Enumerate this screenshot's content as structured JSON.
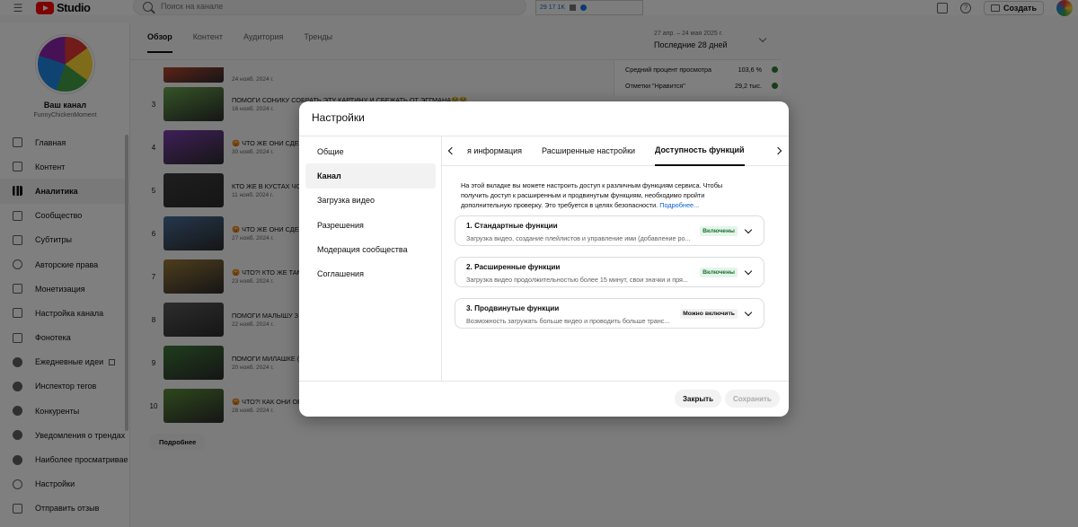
{
  "topbar": {
    "studio_label": "Studio",
    "search_placeholder": "Поиск на канале",
    "extension_text": "29 17 1K",
    "create_label": "Создать"
  },
  "sidebar": {
    "channel_name": "Ваш канал",
    "channel_handle": "FunnyChickenMoment",
    "items": [
      {
        "label": "Главная",
        "active": false
      },
      {
        "label": "Контент",
        "active": false
      },
      {
        "label": "Аналитика",
        "active": true
      },
      {
        "label": "Сообщество",
        "active": false
      },
      {
        "label": "Субтитры",
        "active": false
      },
      {
        "label": "Авторские права",
        "active": false
      },
      {
        "label": "Монетизация",
        "active": false
      },
      {
        "label": "Настройка канала",
        "active": false
      },
      {
        "label": "Фонотека",
        "active": false
      },
      {
        "label": "Ежедневные идеи",
        "active": false
      },
      {
        "label": "Инспектор тегов",
        "active": false
      },
      {
        "label": "Конкуренты",
        "active": false
      },
      {
        "label": "Уведомления о трендах",
        "active": false
      },
      {
        "label": "Наиболее просматривае",
        "active": false
      },
      {
        "label": "Настройки",
        "active": false
      },
      {
        "label": "Отправить отзыв",
        "active": false
      }
    ]
  },
  "main": {
    "tabs": [
      "Обзор",
      "Контент",
      "Аудитория",
      "Тренды"
    ],
    "date_range": "27 апр. – 24 мая 2025 г.",
    "date_label": "Последние 28 дней",
    "more_button": "Подробнее",
    "stats": [
      {
        "label": "Средний процент просмотра",
        "value": "103,6 %"
      },
      {
        "label": "Отметки \"Нравится\"",
        "value": "29,2 тыс."
      }
    ],
    "videos": [
      {
        "rank": "",
        "title": "",
        "date": "24 нояб. 2024 г.",
        "color": "#b8462e"
      },
      {
        "rank": "3",
        "title": "ПОМОГИ СОНИКУ СОБРАТЬ ЭТУ КАРТИНУ И СБЕЖАТЬ ОТ ЭГГМАНА😭😭",
        "date": "16 нояб. 2024 г.",
        "color": "#6aa84f"
      },
      {
        "rank": "4",
        "title": "😡 ЧТО ЖЕ ОНИ СДЕЛ",
        "date": "30 нояб. 2024 г.",
        "color": "#7d3fb0"
      },
      {
        "rank": "5",
        "title": "КТО ЖЕ В КУСТАХ ЧО",
        "date": "11 нояб. 2024 г.",
        "color": "#3d3d3d"
      },
      {
        "rank": "6",
        "title": "😡 ЧТО ЖЕ ОНИ СДЕЛА",
        "date": "27 нояб. 2024 г.",
        "color": "#4a6f9a"
      },
      {
        "rank": "7",
        "title": "😡 ЧТО?! КТО ЖЕ ТАМ",
        "date": "23 нояб. 2024 г.",
        "color": "#9c7b3a"
      },
      {
        "rank": "8",
        "title": "ПОМОГИ МАЛЫШУ З",
        "date": "22 нояб. 2024 г.",
        "color": "#5a5a5a"
      },
      {
        "rank": "9",
        "title": "ПОМОГИ МИЛАШКЕ (",
        "date": "20 нояб. 2024 г.",
        "color": "#3f7a3a"
      },
      {
        "rank": "10",
        "title": "😡 ЧТО?! КАК ОНИ ОБ",
        "date": "28 нояб. 2024 г.",
        "color": "#5c8f3a"
      }
    ]
  },
  "modal": {
    "title": "Настройки",
    "nav": [
      {
        "label": "Общие",
        "active": false
      },
      {
        "label": "Канал",
        "active": true
      },
      {
        "label": "Загрузка видео",
        "active": false
      },
      {
        "label": "Разрешения",
        "active": false
      },
      {
        "label": "Модерация сообщества",
        "active": false
      },
      {
        "label": "Соглашения",
        "active": false
      }
    ],
    "tabs": [
      {
        "label": "я информация",
        "active": false
      },
      {
        "label": "Расширенные настройки",
        "active": false
      },
      {
        "label": "Доступность функций",
        "active": true
      }
    ],
    "intro_text": "На этой вкладке вы можете настроить доступ к различным функциям сервиса. Чтобы получить доступ к расширенным и продвинутым функциям, необходимо пройти дополнительную проверку. Это требуется в целях безопасности.",
    "intro_link": "Подробнее...",
    "features": [
      {
        "title": "1. Стандартные функции",
        "desc": "Загрузка видео, создание плейлистов и управление ими (добавление ро...",
        "status": "Включены",
        "status_type": "on"
      },
      {
        "title": "2. Расширенные функции",
        "desc": "Загрузка видео продолжительностью более 15 минут, свои значки и пря...",
        "status": "Включены",
        "status_type": "on"
      },
      {
        "title": "3. Продвинутые функции",
        "desc": "Возможность загружать больше видео и проводить больше транс...",
        "status": "Можно включить",
        "status_type": "can"
      }
    ],
    "close_label": "Закрыть",
    "save_label": "Сохранить"
  }
}
